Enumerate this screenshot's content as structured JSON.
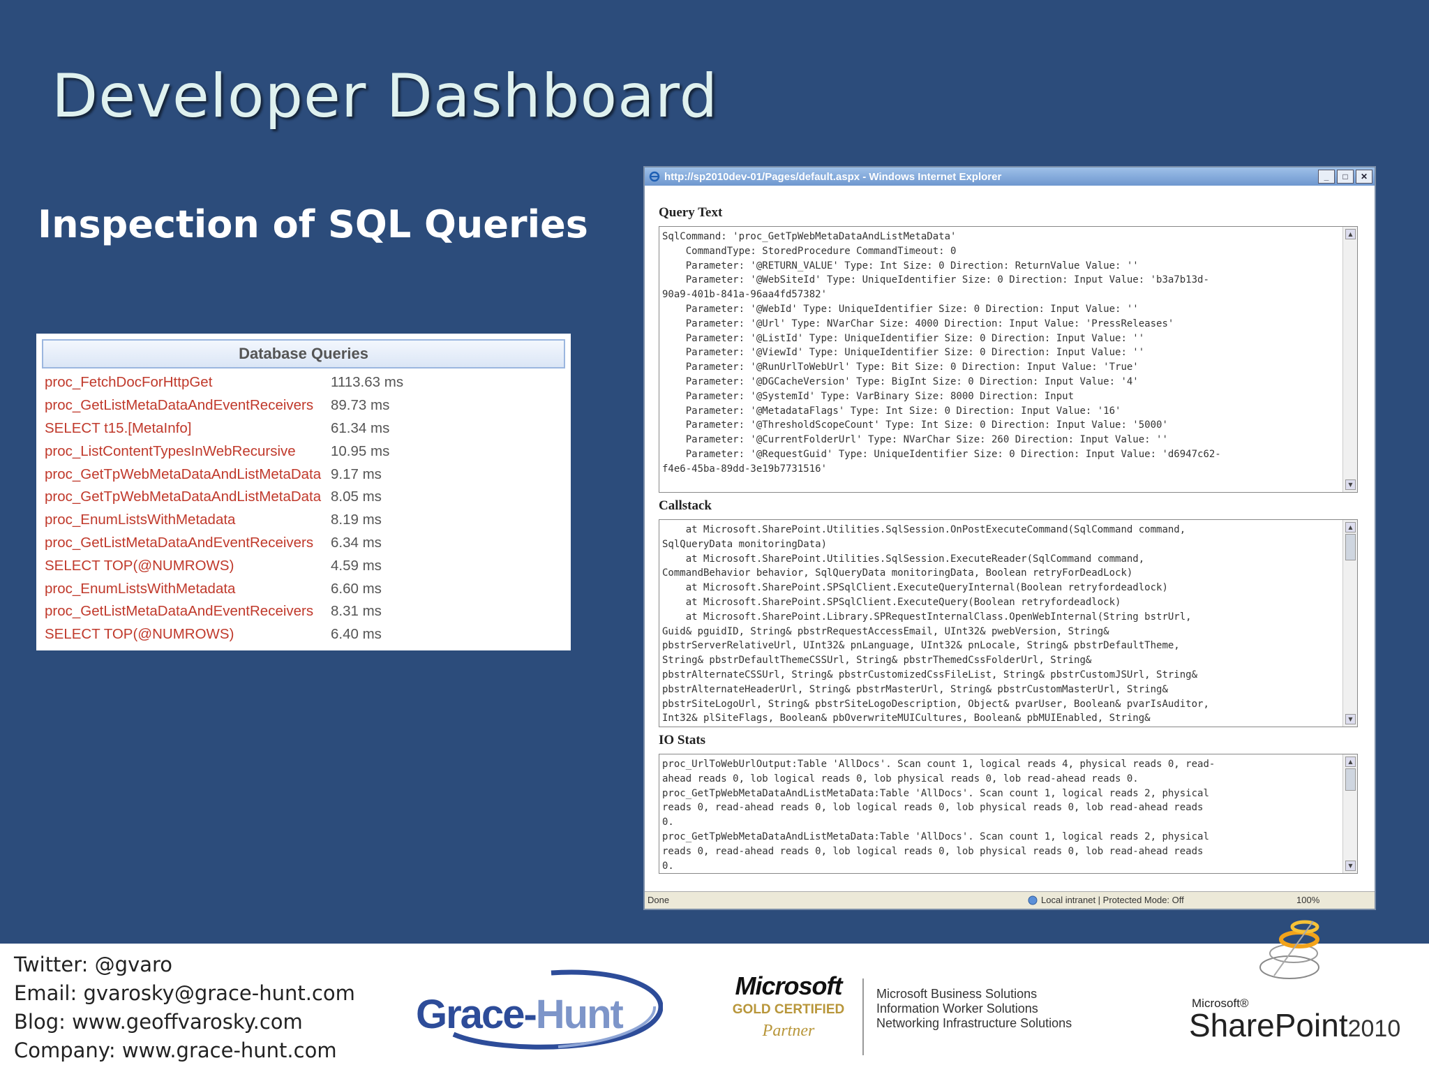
{
  "slide": {
    "title": "Developer Dashboard",
    "subtitle": "Inspection of SQL Queries"
  },
  "database_queries": {
    "header": "Database Queries",
    "rows": [
      {
        "name": "proc_FetchDocForHttpGet",
        "time": "1113.63 ms"
      },
      {
        "name": "proc_GetListMetaDataAndEventReceivers",
        "time": "89.73 ms"
      },
      {
        "name": "SELECT t15.[MetaInfo]",
        "time": "61.34 ms"
      },
      {
        "name": "proc_ListContentTypesInWebRecursive",
        "time": "10.95 ms"
      },
      {
        "name": "proc_GetTpWebMetaDataAndListMetaData",
        "time": "9.17 ms"
      },
      {
        "name": "proc_GetTpWebMetaDataAndListMetaData",
        "time": "8.05 ms"
      },
      {
        "name": "proc_EnumListsWithMetadata",
        "time": "8.19 ms"
      },
      {
        "name": "proc_GetListMetaDataAndEventReceivers",
        "time": "6.34 ms"
      },
      {
        "name": "SELECT TOP(@NUMROWS)",
        "time": "4.59 ms"
      },
      {
        "name": "proc_EnumListsWithMetadata",
        "time": "6.60 ms"
      },
      {
        "name": "proc_GetListMetaDataAndEventReceivers",
        "time": "8.31 ms"
      },
      {
        "name": "SELECT TOP(@NUMROWS)",
        "time": "6.40 ms"
      }
    ]
  },
  "ie_window": {
    "title": "http://sp2010dev-01/Pages/default.aspx - Windows Internet Explorer",
    "minimize": "_",
    "restore": "□",
    "close": "✕",
    "query_text_label": "Query Text",
    "query_text": "SqlCommand: 'proc_GetTpWebMetaDataAndListMetaData'\n    CommandType: StoredProcedure CommandTimeout: 0\n    Parameter: '@RETURN_VALUE' Type: Int Size: 0 Direction: ReturnValue Value: ''\n    Parameter: '@WebSiteId' Type: UniqueIdentifier Size: 0 Direction: Input Value: 'b3a7b13d-\n90a9-401b-841a-96aa4fd57382'\n    Parameter: '@WebId' Type: UniqueIdentifier Size: 0 Direction: Input Value: ''\n    Parameter: '@Url' Type: NVarChar Size: 4000 Direction: Input Value: 'PressReleases'\n    Parameter: '@ListId' Type: UniqueIdentifier Size: 0 Direction: Input Value: ''\n    Parameter: '@ViewId' Type: UniqueIdentifier Size: 0 Direction: Input Value: ''\n    Parameter: '@RunUrlToWebUrl' Type: Bit Size: 0 Direction: Input Value: 'True'\n    Parameter: '@DGCacheVersion' Type: BigInt Size: 0 Direction: Input Value: '4'\n    Parameter: '@SystemId' Type: VarBinary Size: 8000 Direction: Input\n    Parameter: '@MetadataFlags' Type: Int Size: 0 Direction: Input Value: '16'\n    Parameter: '@ThresholdScopeCount' Type: Int Size: 0 Direction: Input Value: '5000'\n    Parameter: '@CurrentFolderUrl' Type: NVarChar Size: 260 Direction: Input Value: ''\n    Parameter: '@RequestGuid' Type: UniqueIdentifier Size: 0 Direction: Input Value: 'd6947c62-\nf4e6-45ba-89dd-3e19b7731516'",
    "callstack_label": "Callstack",
    "callstack": "    at Microsoft.SharePoint.Utilities.SqlSession.OnPostExecuteCommand(SqlCommand command,\nSqlQueryData monitoringData)\n    at Microsoft.SharePoint.Utilities.SqlSession.ExecuteReader(SqlCommand command,\nCommandBehavior behavior, SqlQueryData monitoringData, Boolean retryForDeadLock)\n    at Microsoft.SharePoint.SPSqlClient.ExecuteQueryInternal(Boolean retryfordeadlock)\n    at Microsoft.SharePoint.SPSqlClient.ExecuteQuery(Boolean retryfordeadlock)\n    at Microsoft.SharePoint.Library.SPRequestInternalClass.OpenWebInternal(String bstrUrl,\nGuid& pguidID, String& pbstrRequestAccessEmail, UInt32& pwebVersion, String&\npbstrServerRelativeUrl, UInt32& pnLanguage, UInt32& pnLocale, String& pbstrDefaultTheme,\nString& pbstrDefaultThemeCSSUrl, String& pbstrThemedCssFolderUrl, String&\npbstrAlternateCSSUrl, String& pbstrCustomizedCssFileList, String& pbstrCustomJSUrl, String&\npbstrAlternateHeaderUrl, String& pbstrMasterUrl, String& pbstrCustomMasterUrl, String&\npbstrSiteLogoUrl, String& pbstrSiteLogoDescription, Object& pvarUser, Boolean& pvarIsAuditor,\nInt32& plSiteFlags, Boolean& pbOverwriteMUICultures, Boolean& pbMUIEnabled, String&",
    "io_stats_label": "IO Stats",
    "io_stats": "proc_UrlToWebUrlOutput:Table 'AllDocs'. Scan count 1, logical reads 4, physical reads 0, read-\nahead reads 0, lob logical reads 0, lob physical reads 0, lob read-ahead reads 0.\nproc_GetTpWebMetaDataAndListMetaData:Table 'AllDocs'. Scan count 1, logical reads 2, physical\nreads 0, read-ahead reads 0, lob logical reads 0, lob physical reads 0, lob read-ahead reads\n0.\nproc_GetTpWebMetaDataAndListMetaData:Table 'AllDocs'. Scan count 1, logical reads 2, physical\nreads 0, read-ahead reads 0, lob logical reads 0, lob physical reads 0, lob read-ahead reads\n0.",
    "status_done": "Done",
    "status_zone": "Local intranet | Protected Mode: Off",
    "status_zoom": "100%"
  },
  "footer": {
    "twitter": "Twitter: @gvaro",
    "email": "Email: gvarosky@grace-hunt.com",
    "blog": "Blog: www.geoffvarosky.com",
    "company": "Company: www.grace-hunt.com",
    "grace_hunt_logo": {
      "grace": "Grace",
      "dash": "-",
      "hunt": "Hunt"
    },
    "ms_logo": {
      "microsoft": "Microsoft",
      "gold": "GOLD CERTIFIED",
      "partner": "Partner"
    },
    "ms_solutions": [
      "Microsoft Business Solutions",
      "Information Worker Solutions",
      "Networking Infrastructure Solutions"
    ],
    "sharepoint_logo": {
      "microsoft": "Microsoft®",
      "name": "SharePoint",
      "year": "2010"
    }
  },
  "colors": {
    "background": "#2c4c7b",
    "title": "#dff1ef",
    "query_name": "#c0392b",
    "grace_blue": "#2d4c99"
  }
}
